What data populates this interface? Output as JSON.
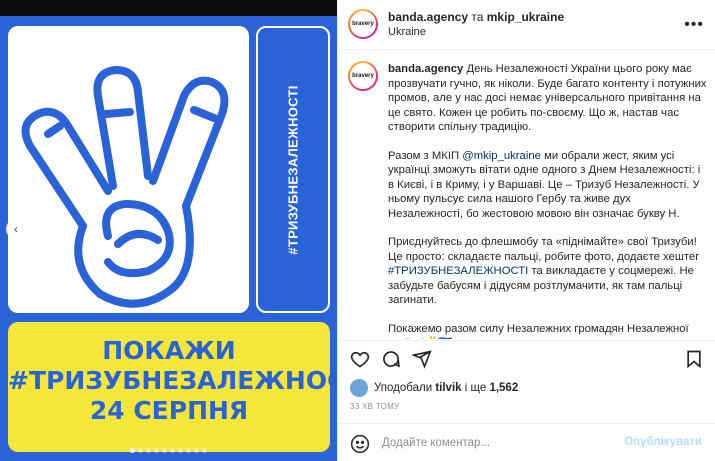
{
  "post": {
    "author": "banda.agency",
    "conjunction": "та",
    "coauthor": "mkip_ukraine",
    "location": "Ukraine",
    "avatar_text": "bravery",
    "more_icon": "more-horizontal-icon"
  },
  "image": {
    "side_text": "#ТРИЗУБНЕЗАЛЕЖНОСТІ",
    "banner_line1": "ПОКАЖИ",
    "banner_line2": "#ТРИЗУБНЕЗАЛЕЖНОСТІ",
    "banner_line3": "24 СЕРПНЯ",
    "slide_count": 10,
    "active_slide": 1,
    "prev_arrow": "‹",
    "colors": {
      "blue": "#2a62d8",
      "yellow": "#f5e63a"
    }
  },
  "caption": {
    "user": "banda.agency",
    "p1": "День Незалежності України цього року має прозвучати гучно, як ніколи. Буде багато контенту і потужних промов, але у нас досі немає універсального привітання на це свято. Кожен це робить по-своєму. Що ж, настав час створити спільну традицію.",
    "p2_a": "Разом з МКІП",
    "p2_link": "@mkip_ukraine",
    "p2_b": "ми обрали жест, яким усі українці зможуть вітати одне одного з Днем Незалежності: і в Києві, і в Криму, і у Варшаві. Це – Тризуб Незалежності. У ньому пульсує сила нашого Гербу та живе дух Незалежності, бо жестовою мовою він означає букву Н.",
    "p3_a": "Приєднуйтесь до флешмобу та «піднімайте» свої Тризуби! Це просто: складаєте пальці, робите фото, додаєте хештег",
    "p3_link": "#ТРИЗУБНЕЗАЛЕЖНОСТІ",
    "p3_b": "та викладаєте у соцмережі. Не забудьте бабусям і дідусям розтлумачити, як там пальці загинати.",
    "p4": "Покажемо разом силу Незалежних громадян Незалежної країни!✌️🇺🇦"
  },
  "likes": {
    "prefix": "Уподобали",
    "user": "tilvik",
    "middle": "і ще",
    "count": "1,562"
  },
  "time": "33 ХВ ТОМУ",
  "comment": {
    "placeholder": "Додайте коментар...",
    "publish": "Опублікувати"
  }
}
